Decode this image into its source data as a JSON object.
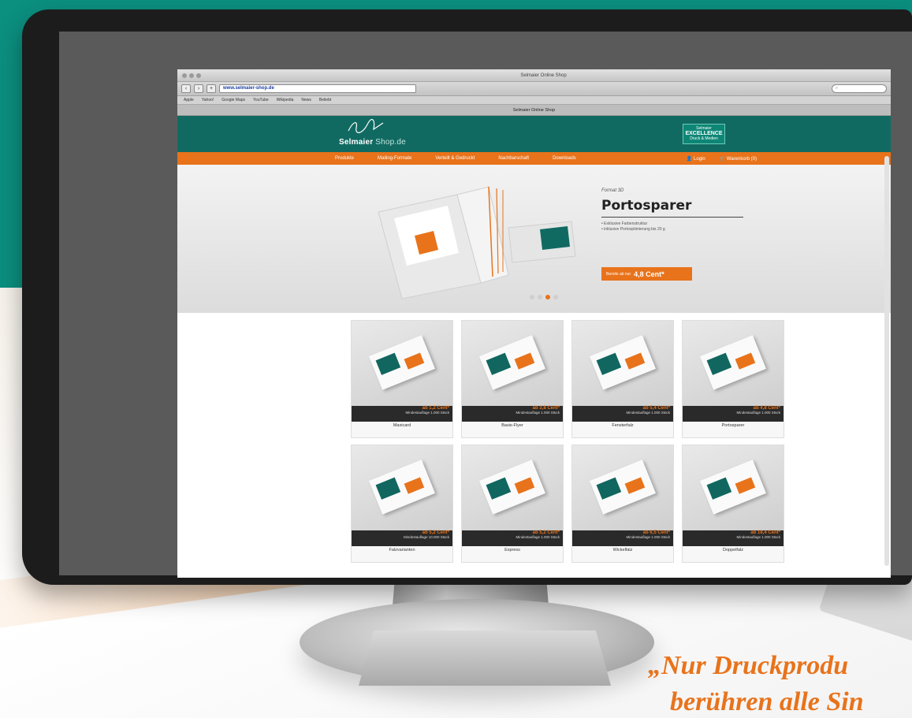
{
  "browser": {
    "window_title": "Selmaier Online Shop",
    "tab_title": "Selmaier Online Shop",
    "url": "www.selmaier-shop.de",
    "bookmarks": [
      "Apple",
      "Yahoo!",
      "Google Maps",
      "YouTube",
      "Wikipedia",
      "News",
      "Beliebt"
    ]
  },
  "site": {
    "logo_name": "Selmaier",
    "logo_suffix": "Shop.de",
    "badge_top": "Selmaier",
    "badge_main": "EXCELLENCE",
    "badge_bottom": "Druck & Medien",
    "nav": [
      "Produkte",
      "Mailing-Formate",
      "Verteilt & Gedruckt",
      "Nachbarschaft",
      "Downloads"
    ],
    "nav_right": [
      "Login",
      "Warenkorb (0)"
    ]
  },
  "hero": {
    "kicker": "Format 3D",
    "title": "Portosparer",
    "bullets": [
      "Exklusive Farbenstruktur",
      "inklusive Portooptimierung bis 20 g"
    ],
    "cta_label": "Bereits ab nur",
    "cta_price": "4,8 Cent*",
    "slides": 4,
    "active_slide": 3
  },
  "products": [
    {
      "price": "ab 1,2 Cent*",
      "sub": "Mindestauflage 1.000 Stück",
      "name": "Maxicard"
    },
    {
      "price": "ab 3,8 Cent*",
      "sub": "Mindestauflage 1.000 Stück",
      "name": "Basis-Flyer"
    },
    {
      "price": "ab 5,4 Cent*",
      "sub": "Mindestauflage 1.000 Stück",
      "name": "Fensterfalz"
    },
    {
      "price": "ab 4,8 Cent*",
      "sub": "Mindestauflage 1.000 Stück",
      "name": "Portosparer"
    },
    {
      "price": "ab 5,2 Cent*",
      "sub": "Mindestauflage 10.000 Stück",
      "name": "Falzvarianten"
    },
    {
      "price": "ab 5,2 Cent*",
      "sub": "Mindestauflage 1.000 Stück",
      "name": "Express"
    },
    {
      "price": "ab 6,5 Cent*",
      "sub": "Mindestauflage 1.000 Stück",
      "name": "Wickelfalz"
    },
    {
      "price": "ab 18,4 Cent*",
      "sub": "Mindestauflage 1.000 Stück",
      "name": "Doppelfalz"
    }
  ],
  "quote": {
    "line1": "„Nur Druckprodu",
    "line2": "berühren alle Sin"
  },
  "colors": {
    "brand_teal": "#116a62",
    "brand_orange": "#e8731b",
    "backdrop_teal": "#0b8f7f"
  }
}
